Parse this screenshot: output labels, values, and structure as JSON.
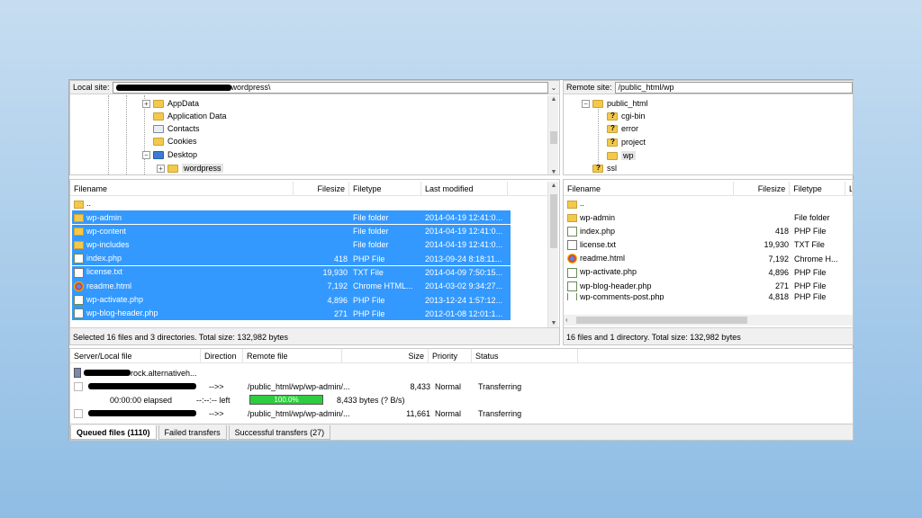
{
  "local_site": {
    "label": "Local site:",
    "path_suffix": "wordpress\\"
  },
  "remote_site": {
    "label": "Remote site:",
    "path": "/public_html/wp"
  },
  "local_tree": [
    "AppData",
    "Application Data",
    "Contacts",
    "Cookies",
    "Desktop",
    "wordpress"
  ],
  "remote_tree": [
    "public_html",
    "cgi-bin",
    "error",
    "project",
    "wp",
    "ssl"
  ],
  "local_headers": [
    "Filename",
    "Filesize",
    "Filetype",
    "Last modified"
  ],
  "local_files": [
    {
      "name": "..",
      "size": "",
      "type": "",
      "modified": "",
      "icon": "folder-icon",
      "selected": false
    },
    {
      "name": "wp-admin",
      "size": "",
      "type": "File folder",
      "modified": "2014-04-19 12:41:0...",
      "icon": "folder-icon",
      "selected": true
    },
    {
      "name": "wp-content",
      "size": "",
      "type": "File folder",
      "modified": "2014-04-19 12:41:0...",
      "icon": "folder-icon",
      "selected": true
    },
    {
      "name": "wp-includes",
      "size": "",
      "type": "File folder",
      "modified": "2014-04-19 12:41:0...",
      "icon": "folder-icon",
      "selected": true
    },
    {
      "name": "index.php",
      "size": "418",
      "type": "PHP File",
      "modified": "2013-09-24 8:18:11...",
      "icon": "php-file-icon",
      "selected": true
    },
    {
      "name": "license.txt",
      "size": "19,930",
      "type": "TXT File",
      "modified": "2014-04-09 7:50:15...",
      "icon": "text-file-icon",
      "selected": true
    },
    {
      "name": "readme.html",
      "size": "7,192",
      "type": "Chrome HTML...",
      "modified": "2014-03-02 9:34:27...",
      "icon": "chrome-html-icon",
      "selected": true
    },
    {
      "name": "wp-activate.php",
      "size": "4,896",
      "type": "PHP File",
      "modified": "2013-12-24 1:57:12...",
      "icon": "php-file-icon",
      "selected": true
    },
    {
      "name": "wp-blog-header.php",
      "size": "271",
      "type": "PHP File",
      "modified": "2012-01-08 12:01:1...",
      "icon": "php-file-icon",
      "selected": true
    }
  ],
  "remote_headers": [
    "Filename",
    "Filesize",
    "Filetype",
    "L"
  ],
  "remote_files": [
    {
      "name": "..",
      "size": "",
      "type": "",
      "icon": "folder-icon"
    },
    {
      "name": "wp-admin",
      "size": "",
      "type": "File folder",
      "icon": "folder-icon"
    },
    {
      "name": "index.php",
      "size": "418",
      "type": "PHP File",
      "icon": "php-file-icon"
    },
    {
      "name": "license.txt",
      "size": "19,930",
      "type": "TXT File",
      "icon": "text-file-icon"
    },
    {
      "name": "readme.html",
      "size": "7,192",
      "type": "Chrome H...",
      "icon": "chrome-html-icon"
    },
    {
      "name": "wp-activate.php",
      "size": "4,896",
      "type": "PHP File",
      "icon": "php-file-icon"
    },
    {
      "name": "wp-blog-header.php",
      "size": "271",
      "type": "PHP File",
      "icon": "php-file-icon"
    },
    {
      "name": "wp-comments-post.php",
      "size": "4,818",
      "type": "PHP File",
      "icon": "php-file-icon"
    }
  ],
  "local_status": "Selected 16 files and 3 directories. Total size: 132,982 bytes",
  "remote_status": "16 files and 1 directory. Total size: 132,982 bytes",
  "queue_headers": [
    "Server/Local file",
    "Direction",
    "Remote file",
    "Size",
    "Priority",
    "Status"
  ],
  "queue": {
    "server_suffix": "rock.alternativeh...",
    "rows": [
      {
        "direction": "-->>",
        "remote": "/public_html/wp/wp-admin/...",
        "size": "8,433",
        "priority": "Normal",
        "status": "Transferring"
      },
      {
        "direction": "-->>",
        "remote": "/public_html/wp/wp-admin/...",
        "size": "11,661",
        "priority": "Normal",
        "status": "Transferring"
      }
    ],
    "elapsed": "00:00:00 elapsed",
    "left": "--:--:-- left",
    "progress_label": "100.0%",
    "progress_fraction": 1.0,
    "bytes": "8,433 bytes (? B/s)"
  },
  "tabs": [
    "Queued files (1110)",
    "Failed transfers",
    "Successful transfers (27)"
  ],
  "colors": {
    "selection": "#3399ff",
    "progress": "#2ecc40"
  }
}
